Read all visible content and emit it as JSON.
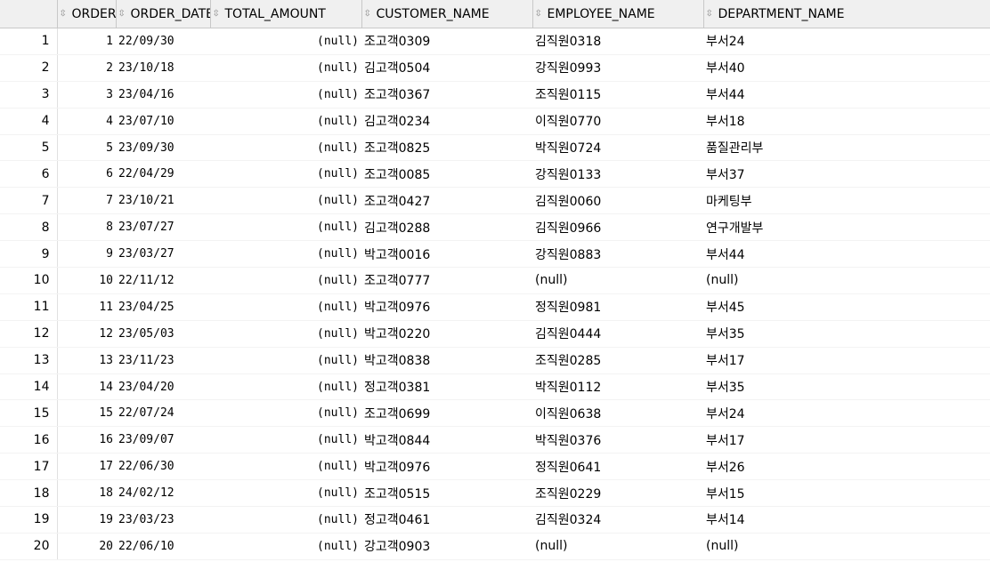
{
  "grid": {
    "columns": [
      "ORDER_ID",
      "ORDER_DATE",
      "TOTAL_AMOUNT",
      "CUSTOMER_NAME",
      "EMPLOYEE_NAME",
      "DEPARTMENT_NAME"
    ],
    "rows": [
      {
        "n": "1",
        "id": "1",
        "date": "22/09/30",
        "amount": "(null)",
        "customer": "조고객0309",
        "employee": "김직원0318",
        "department": "부서24"
      },
      {
        "n": "2",
        "id": "2",
        "date": "23/10/18",
        "amount": "(null)",
        "customer": "김고객0504",
        "employee": "강직원0993",
        "department": "부서40"
      },
      {
        "n": "3",
        "id": "3",
        "date": "23/04/16",
        "amount": "(null)",
        "customer": "조고객0367",
        "employee": "조직원0115",
        "department": "부서44"
      },
      {
        "n": "4",
        "id": "4",
        "date": "23/07/10",
        "amount": "(null)",
        "customer": "김고객0234",
        "employee": "이직원0770",
        "department": "부서18"
      },
      {
        "n": "5",
        "id": "5",
        "date": "23/09/30",
        "amount": "(null)",
        "customer": "조고객0825",
        "employee": "박직원0724",
        "department": "품질관리부"
      },
      {
        "n": "6",
        "id": "6",
        "date": "22/04/29",
        "amount": "(null)",
        "customer": "조고객0085",
        "employee": "강직원0133",
        "department": "부서37"
      },
      {
        "n": "7",
        "id": "7",
        "date": "23/10/21",
        "amount": "(null)",
        "customer": "조고객0427",
        "employee": "김직원0060",
        "department": "마케팅부"
      },
      {
        "n": "8",
        "id": "8",
        "date": "23/07/27",
        "amount": "(null)",
        "customer": "김고객0288",
        "employee": "김직원0966",
        "department": "연구개발부"
      },
      {
        "n": "9",
        "id": "9",
        "date": "23/03/27",
        "amount": "(null)",
        "customer": "박고객0016",
        "employee": "강직원0883",
        "department": "부서44"
      },
      {
        "n": "10",
        "id": "10",
        "date": "22/11/12",
        "amount": "(null)",
        "customer": "조고객0777",
        "employee": "(null)",
        "department": "(null)"
      },
      {
        "n": "11",
        "id": "11",
        "date": "23/04/25",
        "amount": "(null)",
        "customer": "박고객0976",
        "employee": "정직원0981",
        "department": "부서45"
      },
      {
        "n": "12",
        "id": "12",
        "date": "23/05/03",
        "amount": "(null)",
        "customer": "박고객0220",
        "employee": "김직원0444",
        "department": "부서35"
      },
      {
        "n": "13",
        "id": "13",
        "date": "23/11/23",
        "amount": "(null)",
        "customer": "박고객0838",
        "employee": "조직원0285",
        "department": "부서17"
      },
      {
        "n": "14",
        "id": "14",
        "date": "23/04/20",
        "amount": "(null)",
        "customer": "정고객0381",
        "employee": "박직원0112",
        "department": "부서35"
      },
      {
        "n": "15",
        "id": "15",
        "date": "22/07/24",
        "amount": "(null)",
        "customer": "조고객0699",
        "employee": "이직원0638",
        "department": "부서24"
      },
      {
        "n": "16",
        "id": "16",
        "date": "23/09/07",
        "amount": "(null)",
        "customer": "박고객0844",
        "employee": "박직원0376",
        "department": "부서17"
      },
      {
        "n": "17",
        "id": "17",
        "date": "22/06/30",
        "amount": "(null)",
        "customer": "박고객0976",
        "employee": "정직원0641",
        "department": "부서26"
      },
      {
        "n": "18",
        "id": "18",
        "date": "24/02/12",
        "amount": "(null)",
        "customer": "조고객0515",
        "employee": "조직원0229",
        "department": "부서15"
      },
      {
        "n": "19",
        "id": "19",
        "date": "23/03/23",
        "amount": "(null)",
        "customer": "정고객0461",
        "employee": "김직원0324",
        "department": "부서14"
      },
      {
        "n": "20",
        "id": "20",
        "date": "22/06/10",
        "amount": "(null)",
        "customer": "강고객0903",
        "employee": "(null)",
        "department": "(null)"
      }
    ]
  }
}
